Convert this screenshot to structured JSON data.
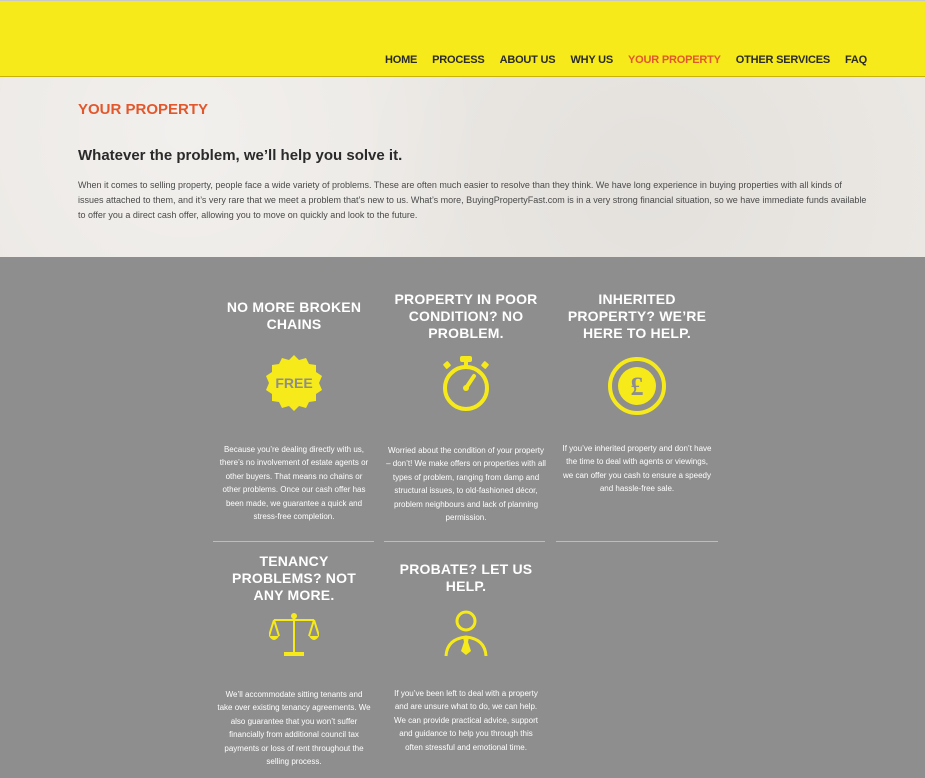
{
  "nav": {
    "items": [
      {
        "label": "HOME",
        "active": false
      },
      {
        "label": "PROCESS",
        "active": false
      },
      {
        "label": "ABOUT US",
        "active": false
      },
      {
        "label": "WHY US",
        "active": false
      },
      {
        "label": "YOUR PROPERTY",
        "active": true
      },
      {
        "label": "OTHER SERVICES",
        "active": false
      },
      {
        "label": "FAQ",
        "active": false
      }
    ]
  },
  "intro": {
    "title": "YOUR PROPERTY",
    "headline": "Whatever the problem, we’ll help you solve it.",
    "body": "When it comes to selling property, people face a wide variety of problems. These are often much easier to resolve than they think. We have long experience in buying properties with all kinds of issues attached to them, and it’s very rare that we meet a problem that’s new to us. What’s more, BuyingPropertyFast.com is in a very strong financial situation, so we have immediate funds available to offer you a direct cash offer, allowing you to move on quickly and look to the future."
  },
  "cards": [
    {
      "title": "NO MORE BROKEN CHAINS",
      "icon": "free-badge-icon",
      "badge_text": "FREE",
      "text": "Because you’re dealing directly with us, there’s no involvement of estate agents or other buyers. That means no chains or other problems. Once our cash offer has been made, we guarantee a quick and stress-free completion."
    },
    {
      "title": "PROPERTY IN POOR CONDITION? NO PROBLEM.",
      "icon": "stopwatch-icon",
      "text": "Worried about the condition of your property – don’t! We make offers on properties with all types of problem, ranging from damp and structural issues, to old-fashioned décor, problem neighbours and lack of planning permission."
    },
    {
      "title": "INHERITED PROPERTY? WE’RE HERE TO HELP.",
      "icon": "pound-coin-icon",
      "text": "If you’ve inherited property and don’t have the time to deal with agents or viewings, we can offer you cash to ensure a speedy and hassle-free sale."
    },
    {
      "title": "TENANCY PROBLEMS? NOT ANY MORE.",
      "icon": "scales-icon",
      "text": "We’ll accommodate sitting tenants and take over existing tenancy agreements. We also guarantee that you won’t suffer financially from additional council tax payments or loss of rent throughout the selling process."
    },
    {
      "title": "PROBATE? LET US HELP.",
      "icon": "advisor-person-icon",
      "text": "If you’ve been left to deal with a property and are unsure what to do, we can help. We can provide practical advice, support and guidance to help you through this often stressful and emotional time."
    }
  ],
  "colors": {
    "header_bg": "#f6ea1a",
    "accent": "#e2582c",
    "icon": "#f6ea1a",
    "panel_bg": "#8e8e8e"
  }
}
